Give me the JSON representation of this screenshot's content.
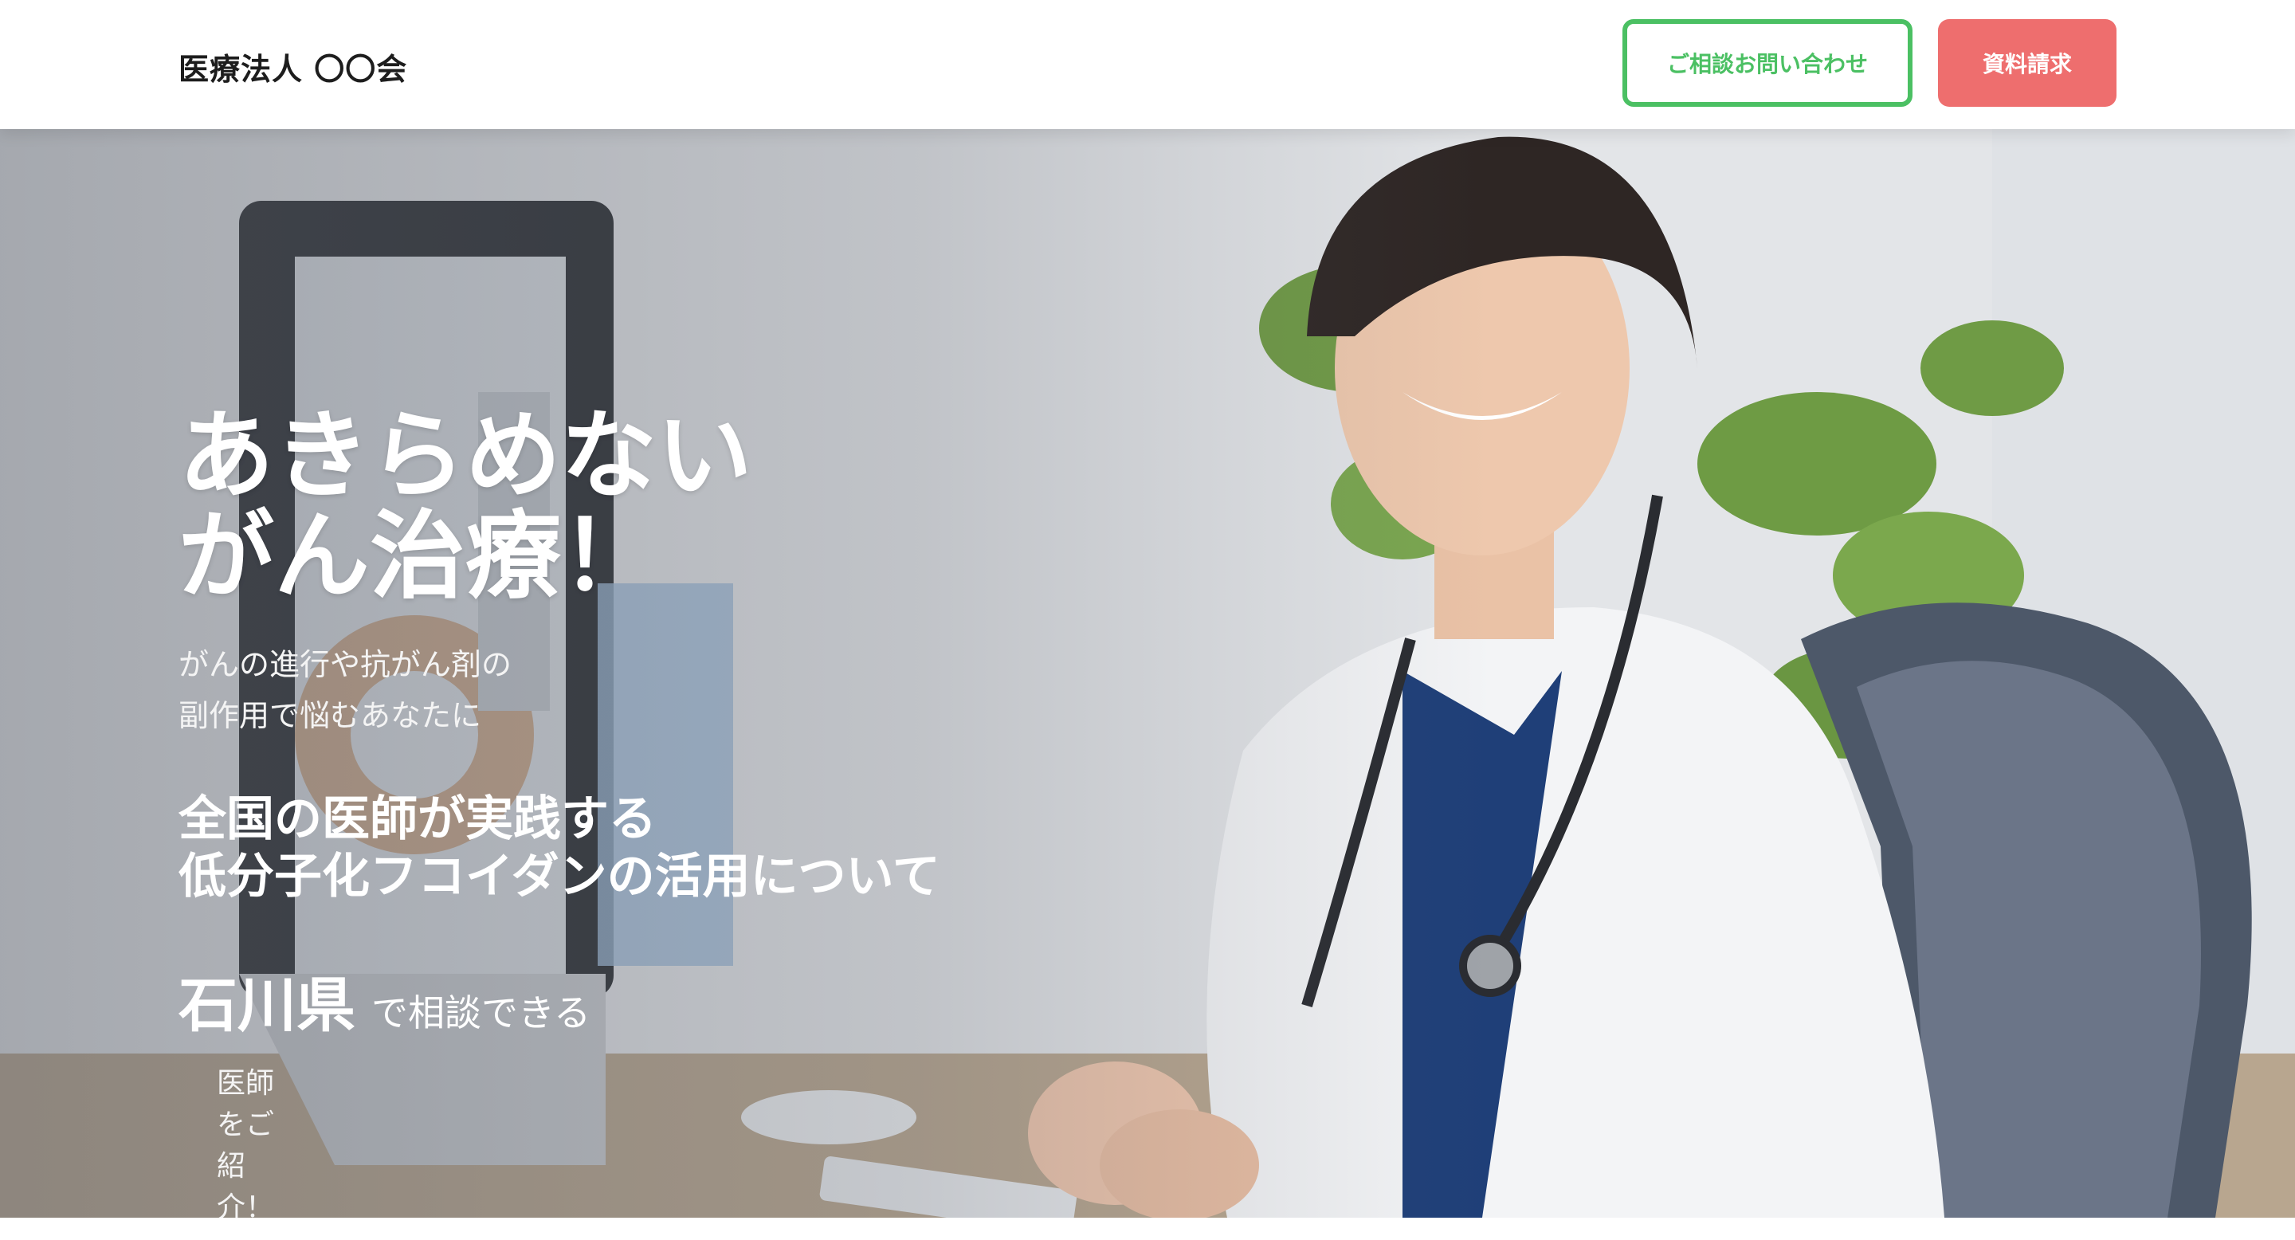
{
  "header": {
    "logo": "医療法人 〇〇会",
    "contact_button": "ご相談お問い合わせ",
    "docs_button": "資料請求",
    "colors": {
      "contact": "#4bc063",
      "docs": "#ee6e6e"
    }
  },
  "hero": {
    "headline": [
      "あきらめない",
      "がん治療！"
    ],
    "sub": [
      "がんの進行や抗がん剤の",
      "副作用で悩むあなたに"
    ],
    "feature": [
      "全国の医師が実践する",
      "低分子化フコイダンの活用について"
    ],
    "location_pref": "石川県",
    "location_text": "で相談できる",
    "intro": "医師をご紹介！"
  }
}
